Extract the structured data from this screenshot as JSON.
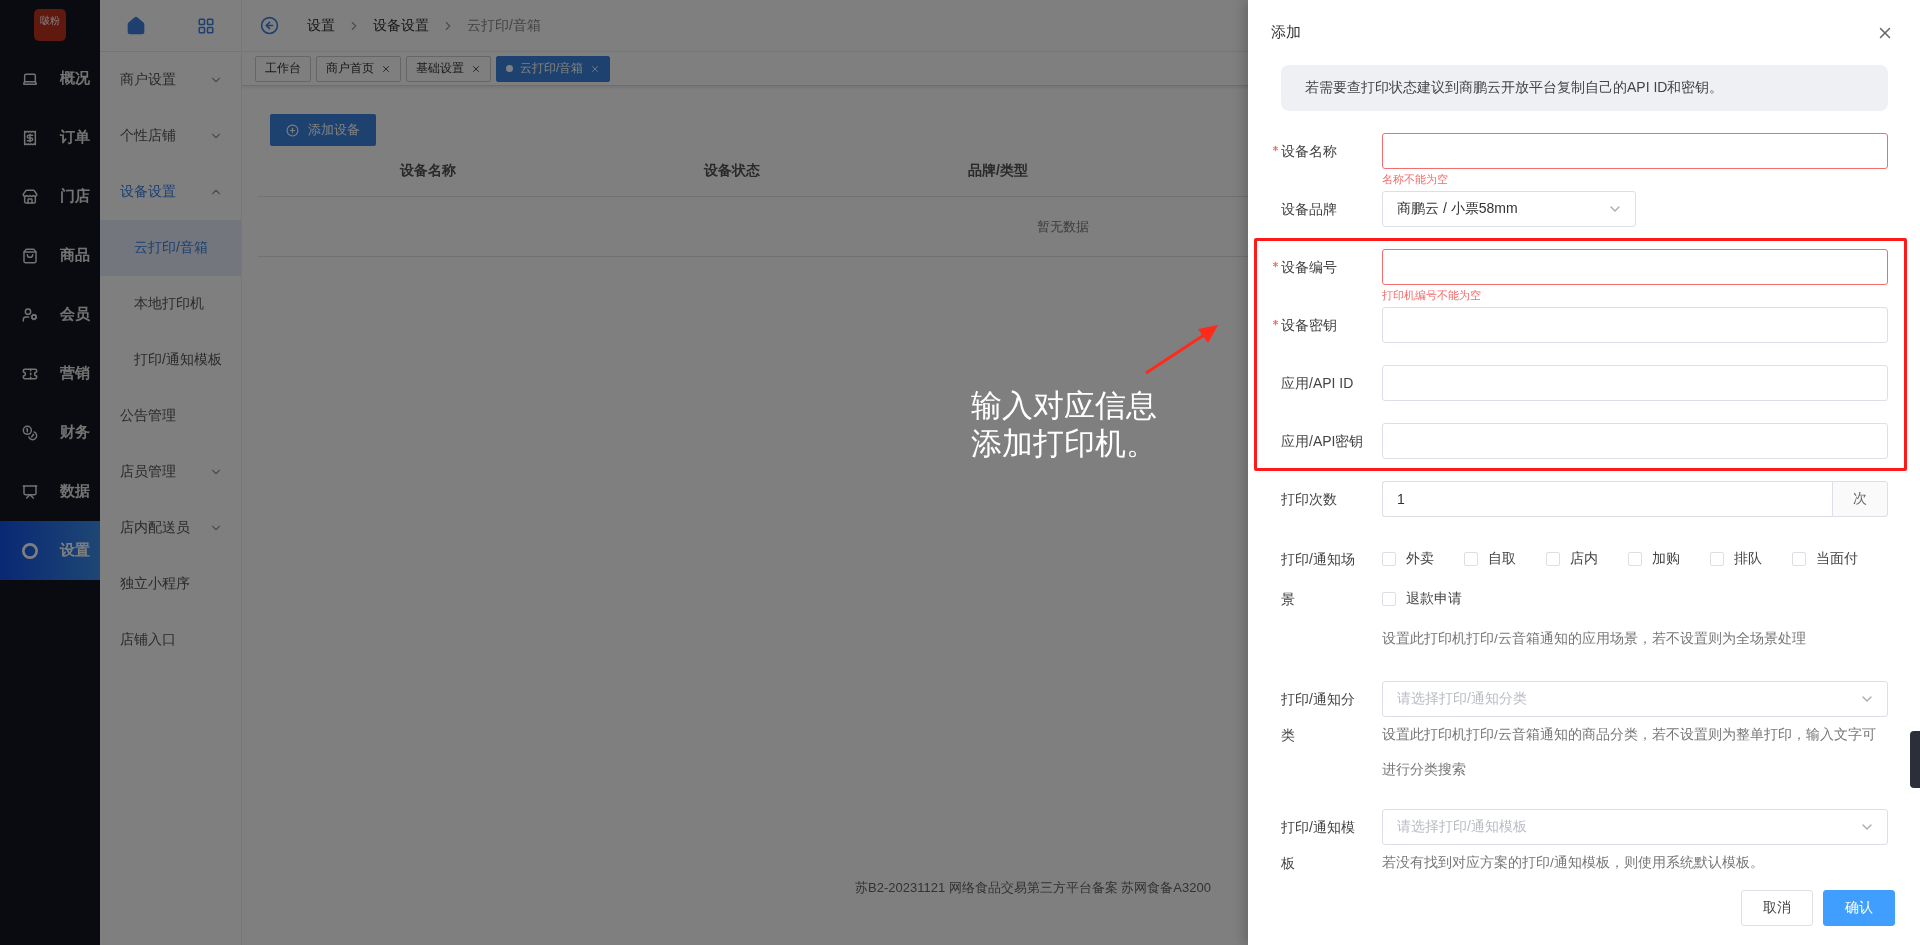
{
  "nav": {
    "logo": "啵粉",
    "items": [
      {
        "label": "概况",
        "selected": false
      },
      {
        "label": "订单",
        "selected": false
      },
      {
        "label": "门店",
        "selected": false
      },
      {
        "label": "商品",
        "selected": false
      },
      {
        "label": "会员",
        "selected": false
      },
      {
        "label": "营销",
        "selected": false
      },
      {
        "label": "财务",
        "selected": false
      },
      {
        "label": "数据",
        "selected": false
      },
      {
        "label": "设置",
        "selected": true
      }
    ]
  },
  "submenu": {
    "items": [
      {
        "label": "商户设置",
        "kind": "group",
        "expanded": false,
        "selected": false
      },
      {
        "label": "个性店铺",
        "kind": "group",
        "expanded": false,
        "selected": false
      },
      {
        "label": "设备设置",
        "kind": "group",
        "expanded": true,
        "selected": true,
        "children": [
          {
            "label": "云打印/音箱",
            "selected": true
          },
          {
            "label": "本地打印机",
            "selected": false
          },
          {
            "label": "打印/通知模板",
            "selected": false
          }
        ]
      },
      {
        "label": "公告管理",
        "kind": "link",
        "selected": false
      },
      {
        "label": "店员管理",
        "kind": "group",
        "expanded": false,
        "selected": false
      },
      {
        "label": "店内配送员",
        "kind": "group",
        "expanded": false,
        "selected": false
      },
      {
        "label": "独立小程序",
        "kind": "link",
        "selected": false
      },
      {
        "label": "店铺入口",
        "kind": "link",
        "selected": false
      }
    ]
  },
  "breadcrumb": [
    "设置",
    "设备设置",
    "云打印/音箱"
  ],
  "tabs": [
    {
      "label": "工作台",
      "selected": false,
      "closable": false
    },
    {
      "label": "商户首页",
      "selected": false,
      "closable": true
    },
    {
      "label": "基础设置",
      "selected": false,
      "closable": true
    },
    {
      "label": "云打印/音箱",
      "selected": true,
      "closable": true
    }
  ],
  "add_button": "添加设备",
  "table": {
    "columns": [
      "设备名称",
      "设备状态",
      "品牌/类型"
    ],
    "empty": "暂无数据"
  },
  "footer": "苏B2-20231121 网络食品交易第三方平台备案 苏网食备A3200",
  "drawer": {
    "title": "添加",
    "notice": "若需要查打印状态建议到商鹏云开放平台复制自己的API ID和密钥。",
    "fields": [
      {
        "kind": "input",
        "label": "设备名称",
        "required": true,
        "error": "名称不能为空"
      },
      {
        "kind": "dropdown",
        "label": "设备品牌",
        "required": false,
        "value": "商鹏云 / 小票58mm"
      },
      {
        "kind": "input",
        "label": "设备编号",
        "required": true,
        "error": "打印机编号不能为空"
      },
      {
        "kind": "input",
        "label": "设备密钥",
        "required": true
      },
      {
        "kind": "input",
        "label": "应用/API ID",
        "required": false
      },
      {
        "kind": "input",
        "label": "应用/API密钥",
        "required": false
      },
      {
        "kind": "input",
        "label": "打印次数",
        "required": false,
        "value": "1",
        "suffix": "次"
      },
      {
        "kind": "checkboxes",
        "label": "打印/通知场景",
        "required": false,
        "hint": "设置此打印机打印/云音箱通知的应用场景，若不设置则为全场景处理",
        "options": [
          {
            "label": "外卖",
            "checked": false
          },
          {
            "label": "自取",
            "checked": false
          },
          {
            "label": "店内",
            "checked": false
          },
          {
            "label": "加购",
            "checked": false
          },
          {
            "label": "排队",
            "checked": false
          },
          {
            "label": "当面付",
            "checked": false
          },
          {
            "label": "退款申请",
            "checked": false
          }
        ]
      },
      {
        "kind": "select",
        "label": "打印/通知分类",
        "required": false,
        "placeholder": "请选择打印/通知分类",
        "hint": "设置此打印机打印/云音箱通知的商品分类，若不设置则为整单打印，输入文字可进行分类搜索"
      },
      {
        "kind": "select",
        "label": "打印/通知模板",
        "required": false,
        "placeholder": "请选择打印/通知模板",
        "hint": "若没有找到对应方案的打印/通知模板，则使用系统默认模板。"
      }
    ],
    "buttons": [
      {
        "label": "取消",
        "kind": "secondary"
      },
      {
        "label": "确认",
        "kind": "primary"
      }
    ]
  },
  "annotation": {
    "lines": [
      "输入对应信息",
      "添加打印机。"
    ]
  }
}
